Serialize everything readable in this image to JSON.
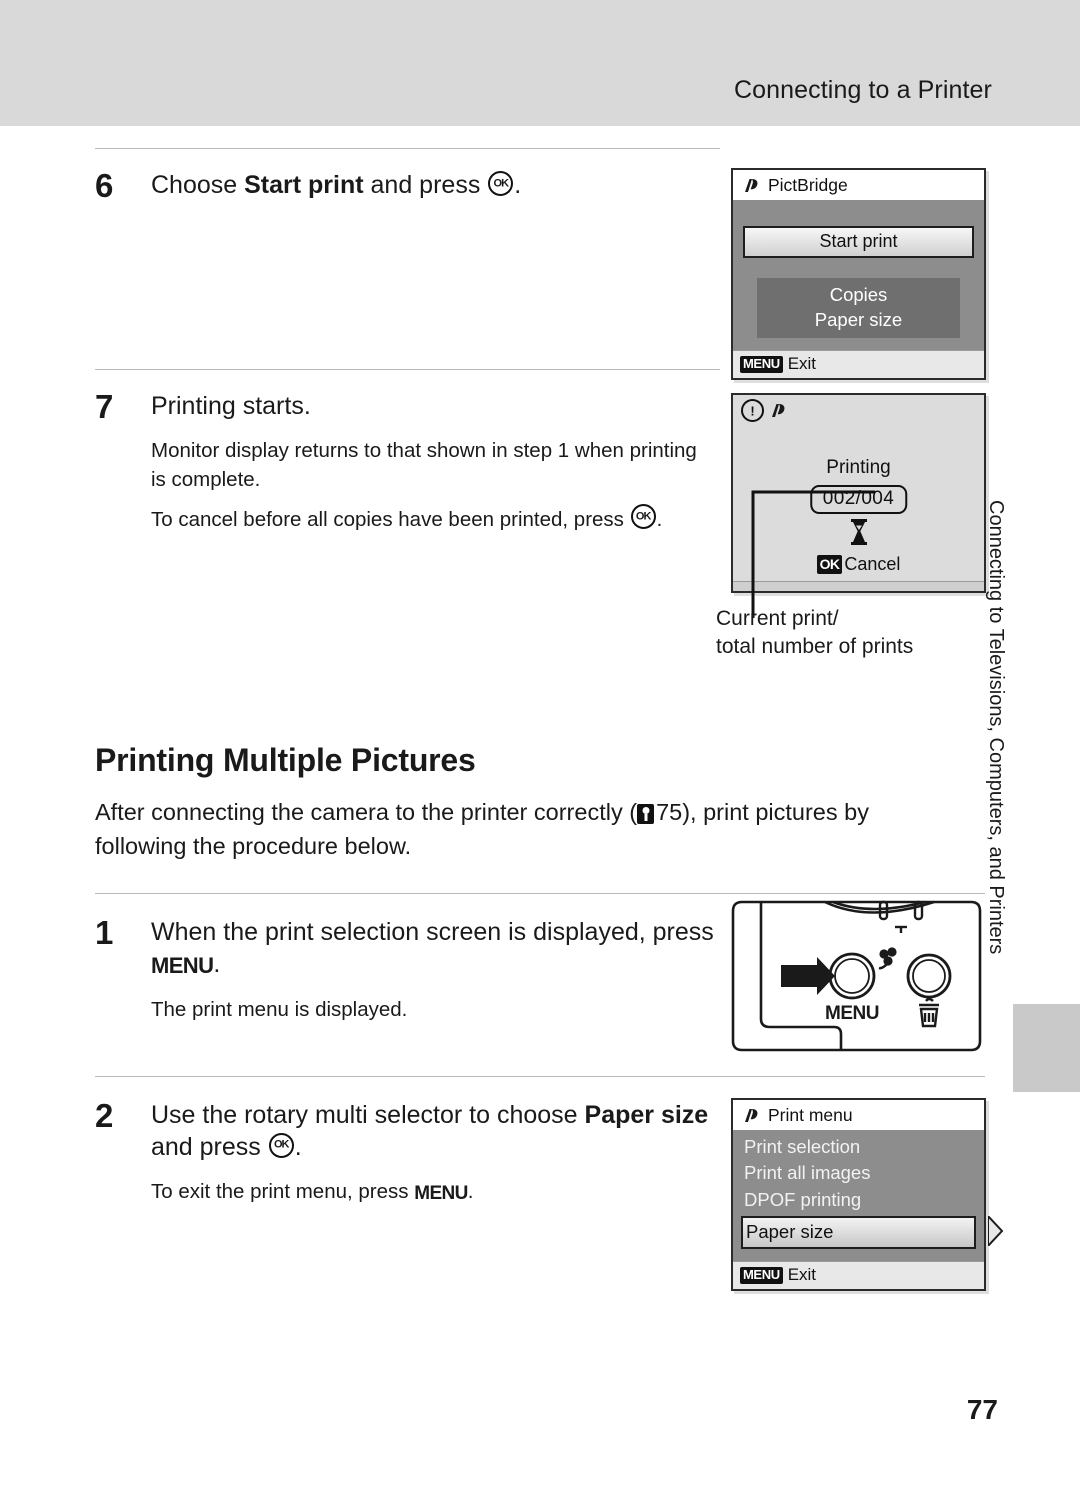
{
  "header": {
    "title": "Connecting to a Printer"
  },
  "side_tab": {
    "text": "Connecting to Televisions, Computers, and Printers"
  },
  "page_number": "77",
  "steps_top": [
    {
      "number": "6",
      "title_pre": "Choose ",
      "title_bold": "Start print",
      "title_post": " and press ",
      "title_end": "."
    },
    {
      "number": "7",
      "title": "Printing starts.",
      "body_line1": "Monitor display returns to that shown in step 1 when printing is complete.",
      "body_line2_pre": "To cancel before all copies have been printed, press ",
      "body_line2_post": "."
    }
  ],
  "section": {
    "heading": "Printing Multiple Pictures",
    "intro_pre": "After connecting the camera to the printer correctly (",
    "intro_ref_page": "75",
    "intro_post": "), print pictures by following the procedure below."
  },
  "steps_bottom": [
    {
      "number": "1",
      "title_pre": "When the print selection screen is displayed, press ",
      "title_menu": "MENU",
      "title_end": ".",
      "body": "The print menu is displayed."
    },
    {
      "number": "2",
      "title_pre": "Use the rotary multi selector to choose ",
      "title_bold": "Paper size",
      "title_mid": " and press ",
      "title_end": ".",
      "body_pre": "To exit the print menu, press ",
      "body_menu": "MENU",
      "body_post": "."
    }
  ],
  "screens": {
    "pictbridge": {
      "title": "PictBridge",
      "selected_button": "Start print",
      "items": [
        "Copies",
        "Paper size"
      ],
      "foot_badge": "MENU",
      "foot_label": "Exit"
    },
    "printing": {
      "label": "Printing",
      "count": "002/004",
      "cancel_badge": "OK",
      "cancel_label": "Cancel",
      "caption_line1": "Current print/",
      "caption_line2": "total number of prints"
    },
    "camera": {
      "menu_label": "MENU"
    },
    "print_menu": {
      "title": "Print menu",
      "items": [
        {
          "label": "Print selection",
          "selected": false
        },
        {
          "label": "Print all images",
          "selected": false
        },
        {
          "label": "DPOF printing",
          "selected": false
        },
        {
          "label": "Paper size",
          "selected": true
        }
      ],
      "foot_badge": "MENU",
      "foot_label": "Exit"
    }
  },
  "colors": {
    "header_band": "#d9d9d9",
    "lcd_panel": "#8d8d8d",
    "lcd_grey_list": "#6f6f6f",
    "printing_bg": "#dcdcdc",
    "rule": "#b9b9b9"
  }
}
